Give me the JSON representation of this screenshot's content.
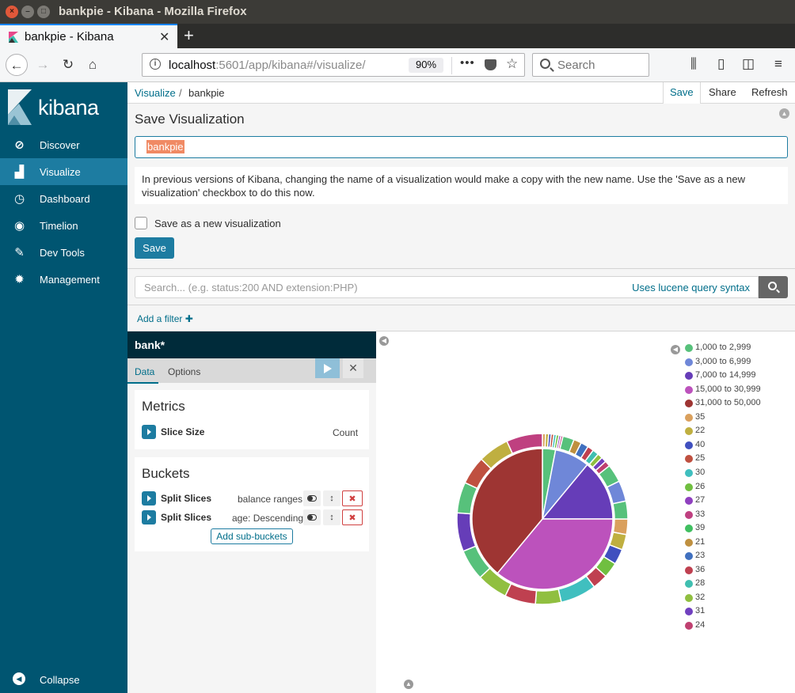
{
  "window": {
    "title": "bankpie - Kibana - Mozilla Firefox"
  },
  "browser": {
    "tab_title": "bankpie - Kibana",
    "url_host": "localhost",
    "url_path": ":5601/app/kibana#/visualize/",
    "zoom": "90%",
    "search_placeholder": "Search"
  },
  "sidebar": {
    "logo_text": "kibana",
    "items": [
      {
        "label": "Discover",
        "icon": "compass-icon"
      },
      {
        "label": "Visualize",
        "icon": "bar-chart-icon",
        "active": true
      },
      {
        "label": "Dashboard",
        "icon": "dashboard-gauge-icon"
      },
      {
        "label": "Timelion",
        "icon": "timelion-mask-icon"
      },
      {
        "label": "Dev Tools",
        "icon": "wrench-icon"
      },
      {
        "label": "Management",
        "icon": "gear-icon"
      }
    ],
    "collapse_label": "Collapse"
  },
  "topnav": {
    "breadcrumb_link": "Visualize",
    "breadcrumb_sep": "/",
    "breadcrumb_current": "bankpie",
    "save_label": "Save",
    "share_label": "Share",
    "refresh_label": "Refresh"
  },
  "save_panel": {
    "title": "Save Visualization",
    "name_value": "bankpie",
    "info_text": "In previous versions of Kibana, changing the name of a visualization would make a copy with the new name. Use the 'Save as a new visualization' checkbox to do this now.",
    "checkbox_label": "Save as a new visualization",
    "checkbox_checked": false,
    "save_button": "Save"
  },
  "query": {
    "placeholder": "Search... (e.g. status:200 AND extension:PHP)",
    "lucene_link": "Uses lucene query syntax",
    "add_filter": "Add a filter"
  },
  "editor": {
    "index_pattern": "bank*",
    "tabs": [
      "Data",
      "Options"
    ],
    "metrics_title": "Metrics",
    "metric": {
      "name": "Slice Size",
      "desc": "Count"
    },
    "buckets_title": "Buckets",
    "buckets": [
      {
        "name": "Split Slices",
        "desc": "balance ranges"
      },
      {
        "name": "Split Slices",
        "desc": "age: Descending"
      }
    ],
    "add_sub_buckets": "Add sub-buckets"
  },
  "legend": [
    {
      "label": "1,000 to 2,999",
      "color": "#57c17b"
    },
    {
      "label": "3,000 to 6,999",
      "color": "#6f87d8"
    },
    {
      "label": "7,000 to 14,999",
      "color": "#663db8"
    },
    {
      "label": "15,000 to 30,999",
      "color": "#bc52bc"
    },
    {
      "label": "31,000 to 50,000",
      "color": "#9e3533"
    },
    {
      "label": "35",
      "color": "#daa05d"
    },
    {
      "label": "22",
      "color": "#bfaf40"
    },
    {
      "label": "40",
      "color": "#4050bf"
    },
    {
      "label": "25",
      "color": "#bf5040"
    },
    {
      "label": "30",
      "color": "#40bfbf"
    },
    {
      "label": "26",
      "color": "#70bf40"
    },
    {
      "label": "27",
      "color": "#8f40bf"
    },
    {
      "label": "33",
      "color": "#bf4080"
    },
    {
      "label": "39",
      "color": "#40bf60"
    },
    {
      "label": "21",
      "color": "#bf9040"
    },
    {
      "label": "23",
      "color": "#4070bf"
    },
    {
      "label": "36",
      "color": "#bf4050"
    },
    {
      "label": "28",
      "color": "#40bfb0"
    },
    {
      "label": "32",
      "color": "#90bf40"
    },
    {
      "label": "31",
      "color": "#7040bf"
    },
    {
      "label": "24",
      "color": "#bf4070"
    }
  ],
  "chart_data": {
    "type": "pie",
    "inner_ring": {
      "labels": [
        "1,000 to 2,999",
        "3,000 to 6,999",
        "7,000 to 14,999",
        "15,000 to 30,999",
        "31,000 to 50,000"
      ],
      "values": [
        3,
        8,
        14,
        36,
        39
      ]
    },
    "outer_ring": {
      "colors": [
        "#daa05d",
        "#bfaf40",
        "#4050bf",
        "#bf5040",
        "#40bfbf",
        "#70bf40",
        "#8f40bf",
        "#bf4080",
        "#57c17b",
        "#bf9040",
        "#4070bf",
        "#bf4050",
        "#40bfb0",
        "#90bf40",
        "#7040bf",
        "#bf4070",
        "#57c17b",
        "#6f87d8",
        "#57c17b",
        "#daa05d",
        "#bfaf40",
        "#4050bf",
        "#70bf40",
        "#bf4050",
        "#40bfbf",
        "#90bf40",
        "#bf4050",
        "#90bf40",
        "#57c17b",
        "#663db8",
        "#57c17b",
        "#bf5040",
        "#bfaf40",
        "#bf4080"
      ],
      "values": [
        0.6,
        0.6,
        0.5,
        0.5,
        0.5,
        0.5,
        0.4,
        0.4,
        2.2,
        1.5,
        1.5,
        1.2,
        1.2,
        1.0,
        1.0,
        1.1,
        3.5,
        4.0,
        3.5,
        3.0,
        3.0,
        3.0,
        3.0,
        3.0,
        7.0,
        5.0,
        6.0,
        6.0,
        6.0,
        7.5,
        6.0,
        5.5,
        6.0,
        7.0
      ]
    }
  }
}
